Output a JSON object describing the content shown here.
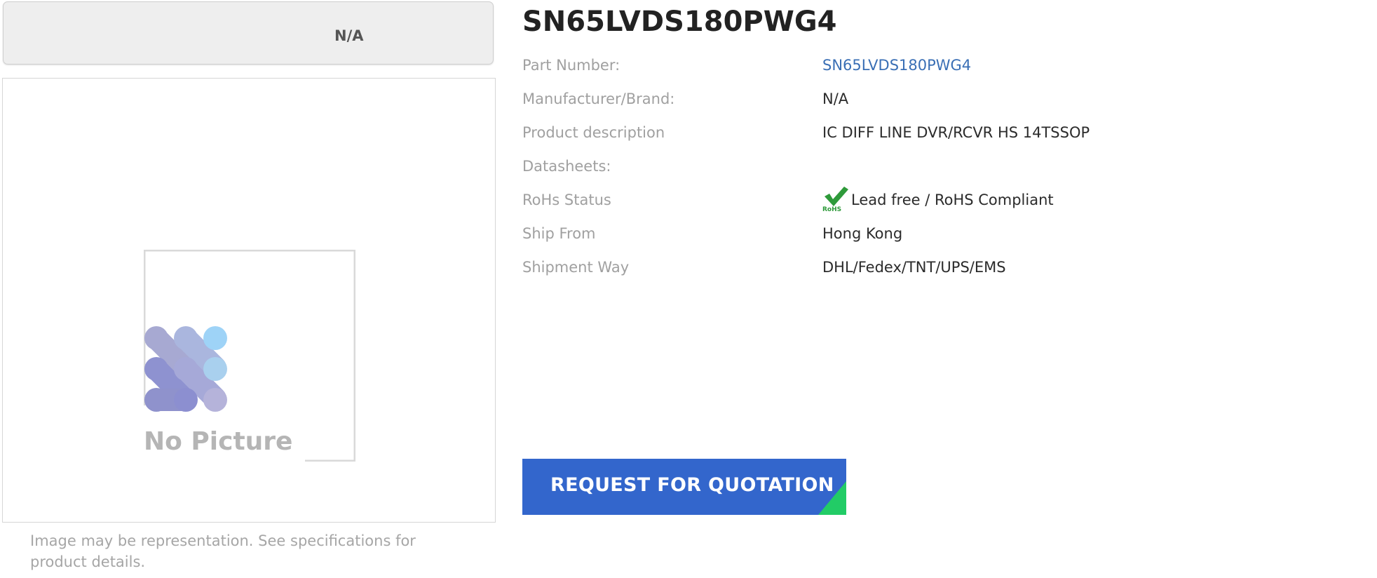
{
  "brand": {
    "label": "N/A"
  },
  "image": {
    "placeholder_text": "No Picture",
    "caption": "Image may be representation. See specifications for product details."
  },
  "product": {
    "title": "SN65LVDS180PWG4",
    "specs": {
      "part_number": {
        "label": "Part Number:",
        "value": "SN65LVDS180PWG4"
      },
      "manufacturer": {
        "label": "Manufacturer/Brand:",
        "value": "N/A"
      },
      "description": {
        "label": "Product description",
        "value": "IC DIFF LINE DVR/RCVR HS 14TSSOP"
      },
      "datasheets": {
        "label": "Datasheets:",
        "value": ""
      },
      "rohs": {
        "label": "RoHs Status",
        "value": "Lead free / RoHS Compliant",
        "icon": "rohs-check-icon",
        "icon_text": "RoHS"
      },
      "ship_from": {
        "label": "Ship From",
        "value": "Hong Kong"
      },
      "shipment_way": {
        "label": "Shipment Way",
        "value": "DHL/Fedex/TNT/UPS/EMS"
      }
    }
  },
  "rfq": {
    "label": "REQUEST FOR QUOTATION"
  },
  "colors": {
    "link": "#3a6fb5",
    "button": "#3366cc",
    "button_accent": "#22cc66",
    "rohs_green": "#2e9a3a"
  }
}
